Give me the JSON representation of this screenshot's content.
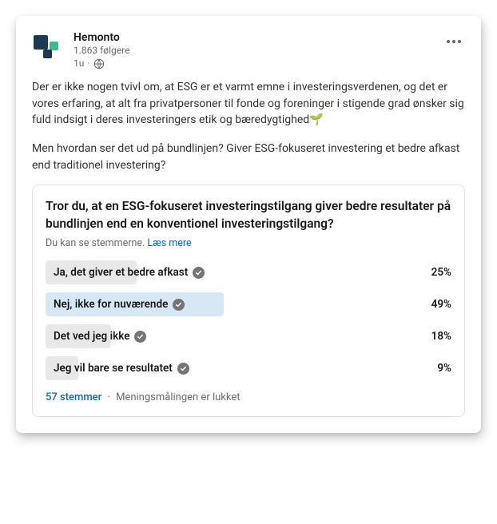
{
  "header": {
    "author": "Hemonto",
    "followers": "1.863 følgere",
    "time": "1u",
    "visibility_icon": "globe-icon"
  },
  "post": {
    "p1": "Der er ikke nogen tvivl om, at ESG er et varmt emne i investeringsverdenen, og det er vores erfaring, at alt fra privatpersoner til fonde og foreninger i stigende grad ønsker sig fuld indsigt i deres investeringers etik og bæredygtighed🌱",
    "p2": "Men hvordan ser det ud på bundlinjen? Giver ESG-fokuseret investering et bedre afkast end traditionel investering?"
  },
  "poll": {
    "question": "Tror du, at en ESG-fokuseret investeringstilgang giver bedre resultater på bundlinjen end en konventionel investeringstilgang?",
    "subtext": "Du kan se stemmerne.",
    "read_more": "Læs mere",
    "options": [
      {
        "label": "Ja, det giver et bedre afkast",
        "pct": "25%",
        "bar": 25,
        "winning": false
      },
      {
        "label": "Nej, ikke for nuværende",
        "pct": "49%",
        "bar": 49,
        "winning": true
      },
      {
        "label": "Det ved jeg ikke",
        "pct": "18%",
        "bar": 18,
        "winning": false
      },
      {
        "label": "Jeg vil bare se resultatet",
        "pct": "9%",
        "bar": 9,
        "winning": false
      }
    ],
    "votes_label": "57 stemmer",
    "closed_label": "Meningsmålingen er lukket"
  },
  "chart_data": {
    "type": "bar",
    "categories": [
      "Ja, det giver et bedre afkast",
      "Nej, ikke for nuværende",
      "Det ved jeg ikke",
      "Jeg vil bare se resultatet"
    ],
    "values": [
      25,
      49,
      18,
      9
    ],
    "title": "Tror du, at en ESG-fokuseret investeringstilgang giver bedre resultater på bundlinjen end en konventionel investeringstilgang?",
    "xlabel": "",
    "ylabel": "%",
    "ylim": [
      0,
      100
    ]
  }
}
